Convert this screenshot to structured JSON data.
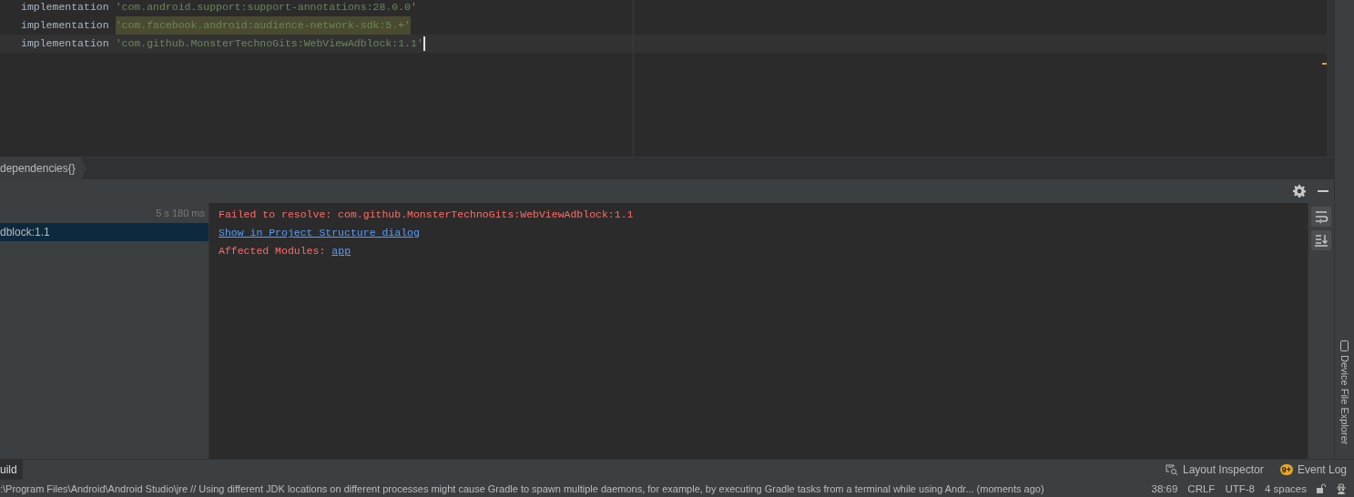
{
  "editor": {
    "lines": [
      {
        "keyword": "implementation",
        "string": "'com.android.support:support-annotations:28.0.0'",
        "highlighted": false,
        "current": false
      },
      {
        "keyword": "implementation",
        "string": "'com.facebook.android:audience-network-sdk:5.+'",
        "highlighted": true,
        "current": false
      },
      {
        "keyword": "implementation",
        "string": "'com.github.MonsterTechnoGits:WebViewAdblock:1.1'",
        "highlighted": false,
        "current": true
      }
    ]
  },
  "breadcrumb": "dependencies{}",
  "build": {
    "duration": "5 s 180 ms",
    "tree": [
      {
        "label": "dblock:1.1",
        "selected": true
      }
    ],
    "console": [
      {
        "kind": "error",
        "text": "Failed to resolve: com.github.MonsterTechnoGits:WebViewAdblock:1.1"
      },
      {
        "kind": "link",
        "text": "Show in Project Structure dialog"
      },
      {
        "kind": "labeled",
        "label": "Affected Modules:",
        "link": "app"
      }
    ]
  },
  "side_stripe": {
    "label": "Device File Explorer"
  },
  "tool_bar": {
    "left": [
      {
        "label": "uild",
        "selected": true
      }
    ],
    "layout_inspector": "Layout Inspector",
    "event_log": "Event Log",
    "event_badge": "9+"
  },
  "status_bar": {
    "message": ":\\Program Files\\Android\\Android Studio\\jre // Using different JDK locations on different processes might cause Gradle to spawn multiple daemons, for example, by executing Gradle tasks from a terminal while using Andr... (moments ago)",
    "position": "38:69",
    "line_separator": "CRLF",
    "encoding": "UTF-8",
    "indent": "4 spaces"
  }
}
